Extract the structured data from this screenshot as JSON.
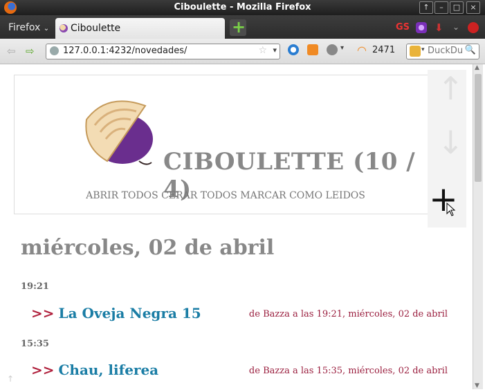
{
  "window": {
    "title": "Ciboulette - Mozilla Firefox"
  },
  "browser": {
    "menu_label": "Firefox",
    "tab_label": "Ciboulette",
    "gs_label": "GS",
    "url": "127.0.0.1:4232/novedades/",
    "feed_count": "2471",
    "search_placeholder": "DuckDu",
    "colors": {
      "new_tab": "#7ad148",
      "gs": "#e33333"
    }
  },
  "page": {
    "brand": "CIBOULETTE (10 / 4)",
    "actions": [
      "ABRIR TODOS",
      "CERAR TODOS",
      "MARCAR COMO LEIDOS"
    ],
    "side_controls": {
      "up_glyph": "↑",
      "down_glyph": "↓",
      "add_glyph": "+"
    },
    "day_heading": "miércoles, 02 de abril",
    "entries": [
      {
        "time": "19:21",
        "marker": ">>",
        "title": "La Oveja Negra 15",
        "meta": "de Bazza a las 19:21, miércoles, 02 de abril"
      },
      {
        "time": "15:35",
        "marker": ">>",
        "title": "Chau, liferea",
        "meta": "de Bazza a las 15:35, miércoles, 02 de abril"
      }
    ],
    "colors": {
      "title": "#1a7da5",
      "marker": "#b0203c",
      "meta": "#9a1e3e",
      "heading": "#888888"
    }
  }
}
